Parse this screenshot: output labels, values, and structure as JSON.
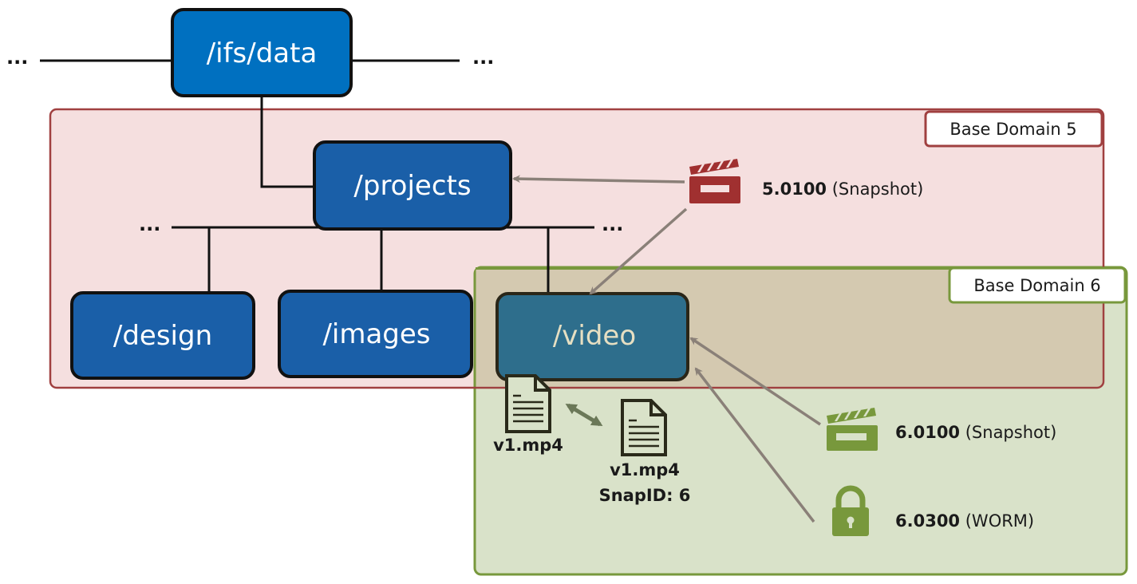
{
  "root": {
    "label": "/ifs/data",
    "ellipsis_left": "...",
    "ellipsis_right": "..."
  },
  "projects": {
    "label": "/projects",
    "ellipsis_left": "...",
    "ellipsis_right": "..."
  },
  "children": [
    {
      "label": "/design"
    },
    {
      "label": "/images"
    },
    {
      "label": "/video"
    }
  ],
  "domains": [
    {
      "label": "Base Domain 5",
      "color": "#a04040"
    },
    {
      "label": "Base Domain 6",
      "color": "#78983c"
    }
  ],
  "policies": [
    {
      "id": "5.0100",
      "type": "(Snapshot)",
      "icon": "clapperboard-icon",
      "color": "#a03030"
    },
    {
      "id": "6.0100",
      "type": "(Snapshot)",
      "icon": "clapperboard-icon",
      "color": "#78983c"
    },
    {
      "id": "6.0300",
      "type": "(WORM)",
      "icon": "lock-icon",
      "color": "#78983c"
    }
  ],
  "files": [
    {
      "name": "v1.mp4",
      "snap": ""
    },
    {
      "name": "v1.mp4",
      "snap": "SnapID: 6"
    }
  ],
  "colors": {
    "node": "#1a5fa8",
    "root_node": "#0070c0",
    "video_node": "#2e6e8c",
    "arrow": "#8a8078"
  }
}
